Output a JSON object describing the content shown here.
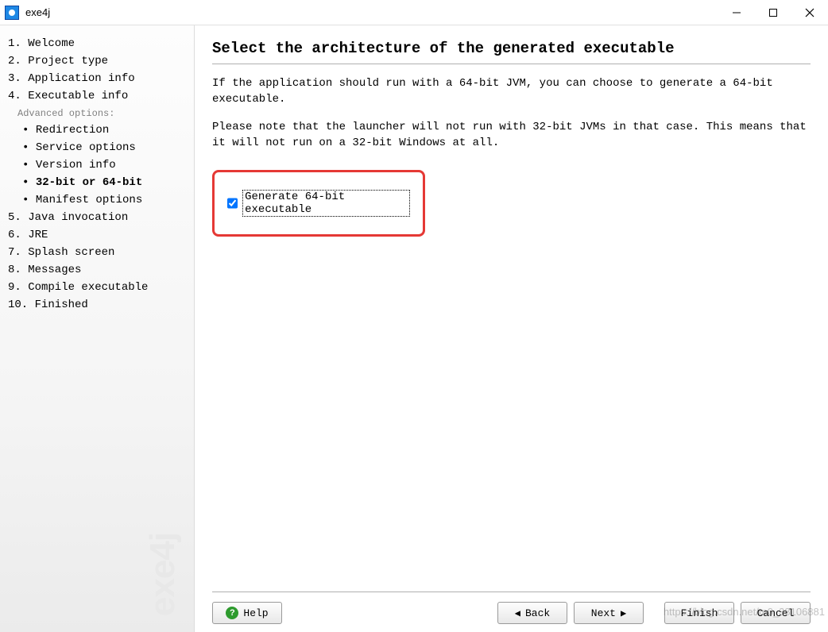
{
  "window": {
    "title": "exe4j"
  },
  "sidebar": {
    "steps": [
      "1. Welcome",
      "2. Project type",
      "3. Application info",
      "4. Executable info"
    ],
    "advanced_label": "Advanced options:",
    "substeps": [
      "Redirection",
      "Service options",
      "Version info",
      "32-bit or 64-bit",
      "Manifest options"
    ],
    "steps_after": [
      "5. Java invocation",
      "6. JRE",
      "7. Splash screen",
      "8. Messages",
      "9. Compile executable",
      "10. Finished"
    ],
    "logo": "exe4j"
  },
  "main": {
    "title": "Select the architecture of the generated executable",
    "p1": "If the application should run with a 64-bit JVM, you can choose to generate a 64-bit executable.",
    "p2": "Please note that the launcher will not run with 32-bit JVMs in that case. This means that it will not run on a 32-bit Windows at all.",
    "checkbox_label": "Generate 64-bit executable",
    "checkbox_checked": true
  },
  "footer": {
    "help": "Help",
    "back": "Back",
    "next": "Next",
    "finish": "Finish",
    "cancel": "Cancel"
  },
  "watermark": "https://blog.csdn.net/m0_38106881"
}
